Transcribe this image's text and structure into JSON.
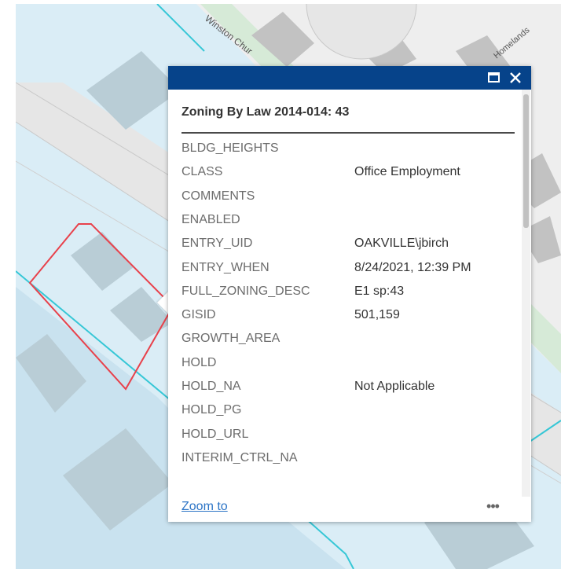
{
  "map": {
    "street_labels": [
      "Winston Chur",
      "Homelands"
    ],
    "colors": {
      "zone_fill": "#daedf6",
      "zone_fill_dark": "#cde5f1",
      "zone_outline": "#36c7d6",
      "building": "#b9cdd6",
      "road": "#eaeaea",
      "road_edge": "#c8c8c8",
      "selection": "#e8414b"
    }
  },
  "popup": {
    "title": "Zoning By Law 2014-014: 43",
    "header_color": "#06438a",
    "buttons": {
      "maximize_icon": "maximize-icon",
      "close_icon": "close-icon",
      "more_label": "•••"
    },
    "attributes": [
      {
        "name": "BLDG_HEIGHTS",
        "value": ""
      },
      {
        "name": "CLASS",
        "value": "Office Employment"
      },
      {
        "name": "COMMENTS",
        "value": ""
      },
      {
        "name": "ENABLED",
        "value": ""
      },
      {
        "name": "ENTRY_UID",
        "value": "OAKVILLE\\jbirch"
      },
      {
        "name": "ENTRY_WHEN",
        "value": "8/24/2021, 12:39 PM"
      },
      {
        "name": "FULL_ZONING_DESC",
        "value": "E1 sp:43"
      },
      {
        "name": "GISID",
        "value": "501,159"
      },
      {
        "name": "GROWTH_AREA",
        "value": ""
      },
      {
        "name": "HOLD",
        "value": ""
      },
      {
        "name": "HOLD_NA",
        "value": "Not Applicable"
      },
      {
        "name": "HOLD_PG",
        "value": ""
      },
      {
        "name": "HOLD_URL",
        "value": ""
      },
      {
        "name": "INTERIM_CTRL_NA",
        "value": ""
      }
    ],
    "footer": {
      "zoom_label": "Zoom to"
    }
  }
}
